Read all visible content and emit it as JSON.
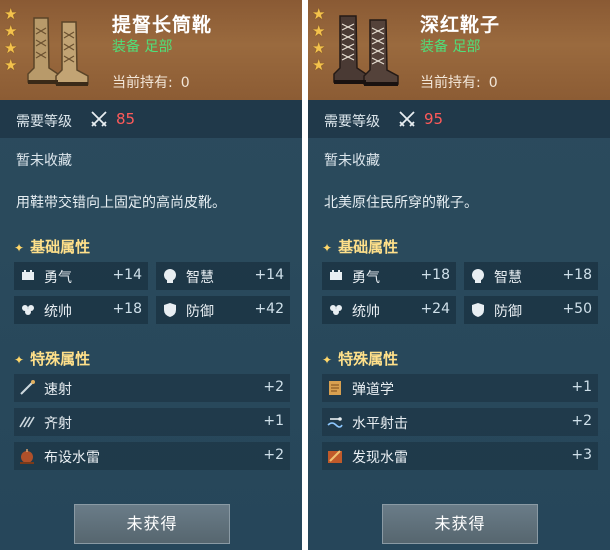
{
  "cards": [
    {
      "name": "提督长筒靴",
      "type": "装备 足部",
      "own_label": "当前持有:",
      "own_count": "0",
      "level_label": "需要等级",
      "level_value": "85",
      "collect_status": "暂未收藏",
      "description": "用鞋带交错向上固定的高尚皮靴。",
      "basic_title": "基础属性",
      "basic_stats": [
        {
          "name": "勇气",
          "value": "+14",
          "icon": "courage-icon"
        },
        {
          "name": "智慧",
          "value": "+14",
          "icon": "wisdom-icon"
        },
        {
          "name": "统帅",
          "value": "+18",
          "icon": "command-icon"
        },
        {
          "name": "防御",
          "value": "+42",
          "icon": "defense-icon"
        }
      ],
      "special_title": "特殊属性",
      "special_stats": [
        {
          "name": "速射",
          "value": "+2",
          "icon": "rapid-fire-icon"
        },
        {
          "name": "齐射",
          "value": "+1",
          "icon": "volley-icon"
        },
        {
          "name": "布设水雷",
          "value": "+2",
          "icon": "lay-mines-icon"
        }
      ],
      "button_label": "未获得",
      "boot_color": "#b89a6a"
    },
    {
      "name": "深红靴子",
      "type": "装备 足部",
      "own_label": "当前持有:",
      "own_count": "0",
      "level_label": "需要等级",
      "level_value": "95",
      "collect_status": "暂未收藏",
      "description": "北美原住民所穿的靴子。",
      "basic_title": "基础属性",
      "basic_stats": [
        {
          "name": "勇气",
          "value": "+18",
          "icon": "courage-icon"
        },
        {
          "name": "智慧",
          "value": "+18",
          "icon": "wisdom-icon"
        },
        {
          "name": "统帅",
          "value": "+24",
          "icon": "command-icon"
        },
        {
          "name": "防御",
          "value": "+50",
          "icon": "defense-icon"
        }
      ],
      "special_title": "特殊属性",
      "special_stats": [
        {
          "name": "弹道学",
          "value": "+1",
          "icon": "ballistics-icon"
        },
        {
          "name": "水平射击",
          "value": "+2",
          "icon": "horizontal-shot-icon"
        },
        {
          "name": "发现水雷",
          "value": "+3",
          "icon": "detect-mines-icon"
        }
      ],
      "button_label": "未获得",
      "boot_color": "#4a3a34"
    }
  ],
  "colors": {
    "level_required": "#ff5a5a",
    "item_type": "#4fe07a",
    "section_title": "#ffe08a",
    "stars": "#f4c24c"
  }
}
